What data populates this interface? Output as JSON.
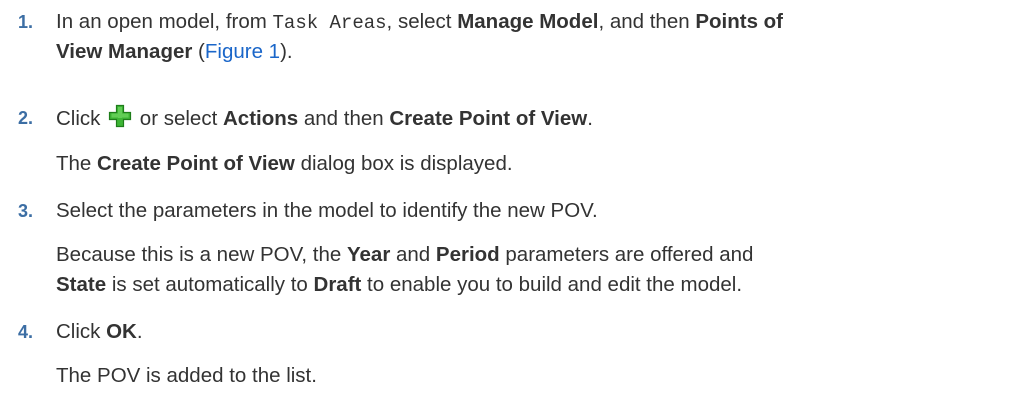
{
  "steps": [
    {
      "number": "1.",
      "text_a": "In an open model, from ",
      "code": "Task Areas",
      "text_b": ", select ",
      "bold_a": "Manage Model",
      "text_c": ", and then ",
      "bold_b": "Points of",
      "bold_c": "View Manager",
      "text_d": " (",
      "link": "Figure 1",
      "text_e": ")."
    },
    {
      "number": "2.",
      "text_a": "Click ",
      "icon": "add-plus-icon",
      "text_b": " or select ",
      "bold_a": "Actions",
      "text_c": " and then ",
      "bold_b": "Create Point of View",
      "text_d": ".",
      "result_a": "The ",
      "result_bold": "Create Point of View",
      "result_b": " dialog box is displayed."
    },
    {
      "number": "3.",
      "text": "Select the parameters in the model to identify the new POV.",
      "para_a": "Because this is a new POV, the ",
      "para_bold_a": "Year",
      "para_b": " and ",
      "para_bold_b": "Period",
      "para_c": " parameters are offered and",
      "para_bold_c": "State",
      "para_d": " is set automatically to ",
      "para_bold_d": "Draft",
      "para_e": " to enable you to build and edit the model."
    },
    {
      "number": "4.",
      "text_a": "Click ",
      "bold_a": "OK",
      "text_b": ".",
      "result": "The POV is added to the list."
    }
  ],
  "colors": {
    "step_number": "#3c6ea4",
    "link": "#1a66c9",
    "text": "#333333",
    "icon_green": "#3db535"
  }
}
